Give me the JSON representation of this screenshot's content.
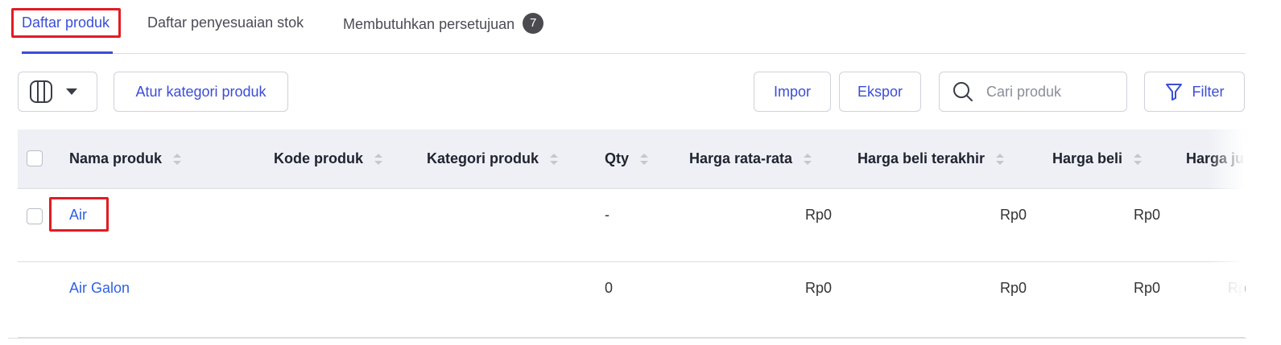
{
  "tabs": [
    {
      "label": "Daftar produk",
      "active": true
    },
    {
      "label": "Daftar penyesuaian stok",
      "active": false
    },
    {
      "label": "Membutuhkan persetujuan",
      "active": false,
      "badge": "7"
    }
  ],
  "toolbar": {
    "column_icon": "columns-icon",
    "dropdown_icon": "caret-down-icon",
    "category_label": "Atur kategori produk",
    "import_label": "Impor",
    "export_label": "Ekspor",
    "search_placeholder": "Cari produk",
    "search_value": "",
    "filter_label": "Filter",
    "filter_icon": "filter-icon"
  },
  "table": {
    "columns": [
      "Nama produk",
      "Kode produk",
      "Kategori produk",
      "Qty",
      "Harga rata-rata",
      "Harga beli terakhir",
      "Harga beli",
      "Harga ju"
    ],
    "rows": [
      {
        "name": "Air",
        "code": "",
        "category": "",
        "qty": "-",
        "avg_price": "Rp0",
        "last_buy_price": "Rp0",
        "buy_price": "Rp0",
        "sell_price": ""
      },
      {
        "name": "Air Galon",
        "code": "",
        "category": "",
        "qty": "0",
        "avg_price": "Rp0",
        "last_buy_price": "Rp0",
        "buy_price": "Rp0",
        "sell_price": "Rp"
      }
    ]
  },
  "colors": {
    "accent": "#3b4dd8",
    "link": "#2f61e6",
    "highlight": "#e31b23",
    "header_bg": "#eef0f5"
  }
}
